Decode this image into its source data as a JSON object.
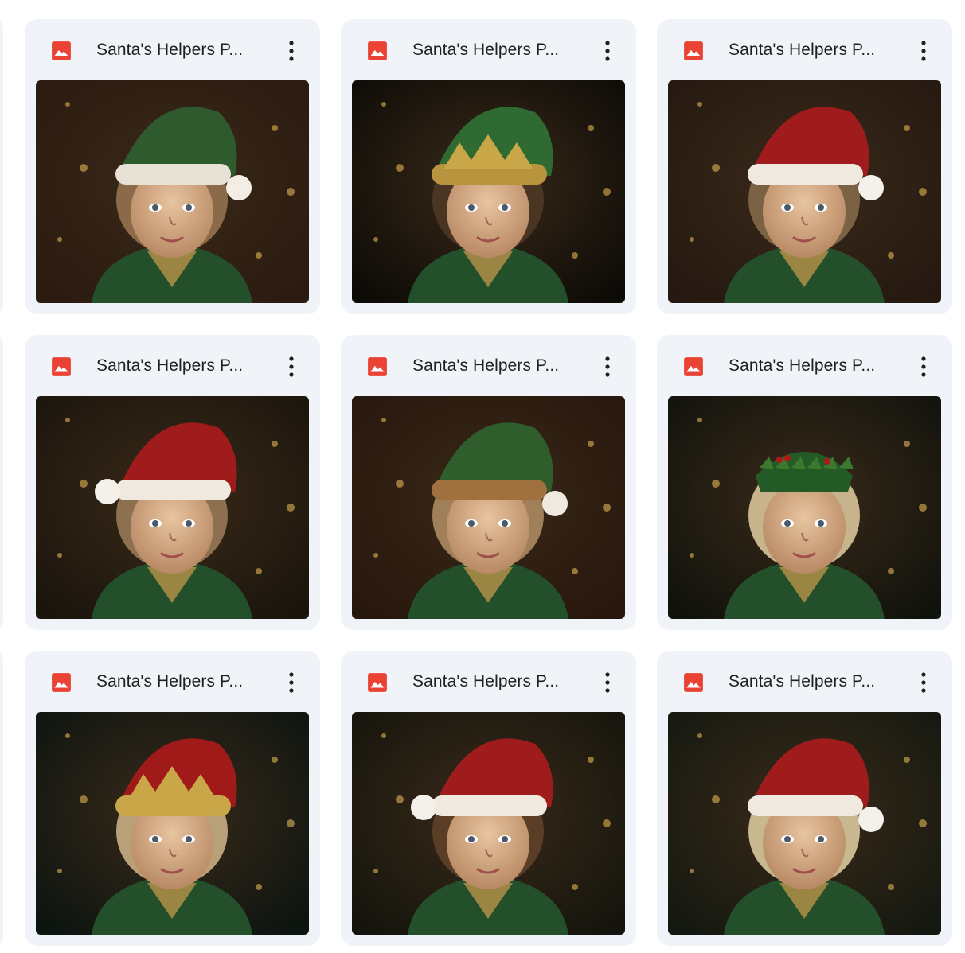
{
  "files": [
    {
      "title": "Santa's Helpers P...",
      "icon": "image-file-icon",
      "menu_icon": "more-vert-icon",
      "hat": "green",
      "hair": "#8a6a48",
      "bg": "#2a1a10"
    },
    {
      "title": "Santa's Helpers P...",
      "icon": "image-file-icon",
      "menu_icon": "more-vert-icon",
      "hat": "green-crown",
      "hair": "#4a3422",
      "bg": "#0c0a06"
    },
    {
      "title": "Santa's Helpers P...",
      "icon": "image-file-icon",
      "menu_icon": "more-vert-icon",
      "hat": "red",
      "hair": "#7c6244",
      "bg": "#241810"
    },
    {
      "title": "Santa's Helpers P...",
      "icon": "image-file-icon",
      "menu_icon": "more-vert-icon",
      "hat": "red",
      "hair": "#8c7050",
      "bg": "#1a140c"
    },
    {
      "title": "Santa's Helpers P...",
      "icon": "image-file-icon",
      "menu_icon": "more-vert-icon",
      "hat": "green-brown",
      "hair": "#a08058",
      "bg": "#26160c"
    },
    {
      "title": "Santa's Helpers P...",
      "icon": "image-file-icon",
      "menu_icon": "more-vert-icon",
      "hat": "holly",
      "hair": "#c8b48c",
      "bg": "#10120c"
    },
    {
      "title": "Santa's Helpers P...",
      "icon": "image-file-icon",
      "menu_icon": "more-vert-icon",
      "hat": "red-crown",
      "hair": "#b8a078",
      "bg": "#0c1410"
    },
    {
      "title": "Santa's Helpers P...",
      "icon": "image-file-icon",
      "menu_icon": "more-vert-icon",
      "hat": "red",
      "hair": "#5a3e26",
      "bg": "#14140c"
    },
    {
      "title": "Santa's Helpers P...",
      "icon": "image-file-icon",
      "menu_icon": "more-vert-icon",
      "hat": "red",
      "hair": "#c8b890",
      "bg": "#141810"
    }
  ],
  "colors": {
    "card_bg": "#f0f4f9",
    "title_text": "#1f1f1f",
    "image_icon_red": "#ea4335",
    "menu_dots": "#1f1f1f"
  }
}
